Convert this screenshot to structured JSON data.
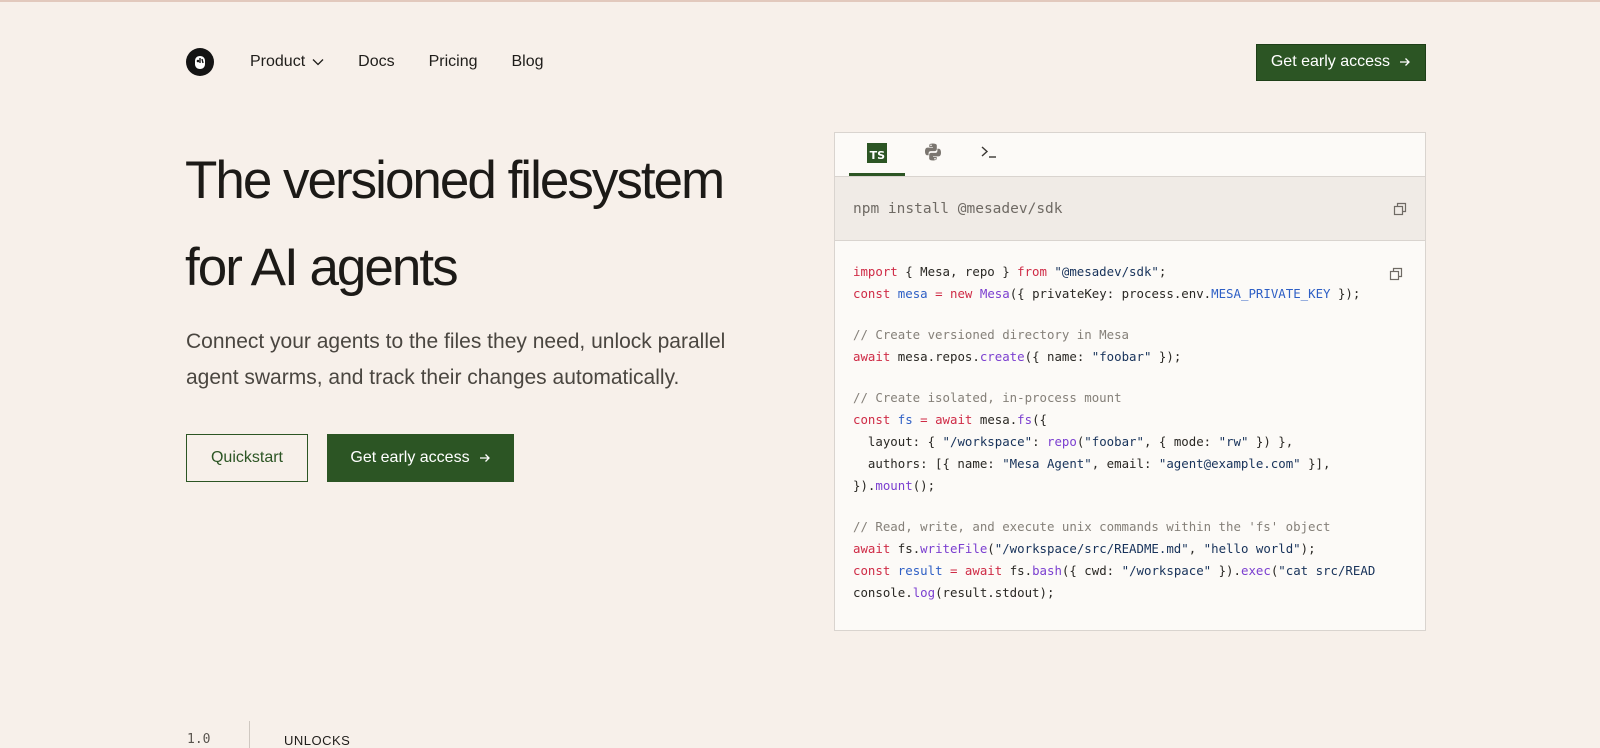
{
  "nav": {
    "items": [
      "Product",
      "Docs",
      "Pricing",
      "Blog"
    ],
    "cta": "Get early access"
  },
  "hero": {
    "title_line1": "The versioned filesystem",
    "title_line2": "for AI agents",
    "subtitle": "Connect your agents to the files they need, unlock parallel agent swarms, and track their changes automatically.",
    "quickstart": "Quickstart",
    "cta": "Get early access"
  },
  "panel": {
    "tabs": [
      "ts-icon",
      "python-icon",
      "terminal-icon"
    ],
    "install_cmd": "npm install @mesadev/sdk",
    "code": {
      "l1a": "import",
      "l1b": " { Mesa, repo } ",
      "l1c": "from",
      "l1d": " \"@mesadev/sdk\"",
      "l1e": ";",
      "l2a": "const",
      "l2b": " mesa",
      "l2c": " = ",
      "l2d": "new",
      "l2e": " Mesa",
      "l2f": "({ privateKey: process.env.",
      "l2g": "MESA_PRIVATE_KEY",
      "l2h": " });",
      "c1": "// Create versioned directory in Mesa",
      "l3a": "await",
      "l3b": " mesa.repos.",
      "l3c": "create",
      "l3d": "({ name: ",
      "l3e": "\"foobar\"",
      "l3f": " });",
      "c2": "// Create isolated, in-process mount",
      "l4a": "const",
      "l4b": " fs",
      "l4c": " = ",
      "l4d": "await",
      "l4e": " mesa.",
      "l4f": "fs",
      "l4g": "({",
      "l5a": "  layout: { ",
      "l5b": "\"/workspace\"",
      "l5c": ": ",
      "l5d": "repo",
      "l5e": "(",
      "l5f": "\"foobar\"",
      "l5g": ", { mode: ",
      "l5h": "\"rw\"",
      "l5i": " }) },",
      "l6a": "  authors: [{ name: ",
      "l6b": "\"Mesa Agent\"",
      "l6c": ", email: ",
      "l6d": "\"agent@example.com\"",
      "l6e": " }],",
      "l7a": "}).",
      "l7b": "mount",
      "l7c": "();",
      "c3": "// Read, write, and execute unix commands within the 'fs' object",
      "l8a": "await",
      "l8b": " fs.",
      "l8c": "writeFile",
      "l8d": "(",
      "l8e": "\"/workspace/src/README.md\"",
      "l8f": ", ",
      "l8g": "\"hello world\"",
      "l8h": ");",
      "l9a": "const",
      "l9b": " result",
      "l9c": " = ",
      "l9d": "await",
      "l9e": " fs.",
      "l9f": "bash",
      "l9g": "({ cwd: ",
      "l9h": "\"/workspace\"",
      "l9i": " }).",
      "l9j": "exec",
      "l9k": "(",
      "l9l": "\"cat src/READ",
      "l10a": "console.",
      "l10b": "log",
      "l10c": "(result.stdout);"
    }
  },
  "footer": {
    "num": "1.0",
    "label": "UNLOCKS"
  },
  "colors": {
    "background": "#f7f0ea",
    "brand_green": "#2c5524",
    "keyword": "#cf2b46",
    "function": "#7b3fd0",
    "comment": "#858079"
  }
}
